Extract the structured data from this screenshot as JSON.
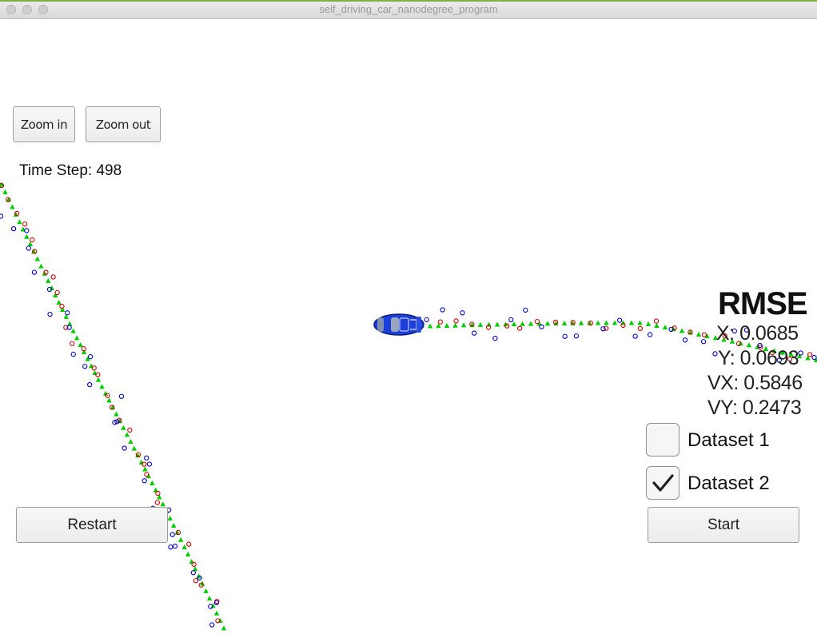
{
  "window": {
    "title": "self_driving_car_nanodegree_program"
  },
  "toolbar": {
    "zoom_in_label": "Zoom in",
    "zoom_out_label": "Zoom out"
  },
  "status": {
    "time_step_label": "Time Step: 498"
  },
  "rmse": {
    "title": "RMSE",
    "x": "X: 0.0685",
    "y": "Y: 0.0693",
    "vx": "VX: 0.5846",
    "vy": "VY: 0.2473"
  },
  "datasets": [
    {
      "label": "Dataset 1",
      "checked": false
    },
    {
      "label": "Dataset 2",
      "checked": true
    }
  ],
  "controls": {
    "restart_label": "Restart",
    "start_label": "Start"
  },
  "legend_colors": {
    "estimation_marker": "#00cc00",
    "lidar_marker": "#d40000",
    "radar_marker": "#0000cc",
    "car_body": "#1a3ad6"
  }
}
